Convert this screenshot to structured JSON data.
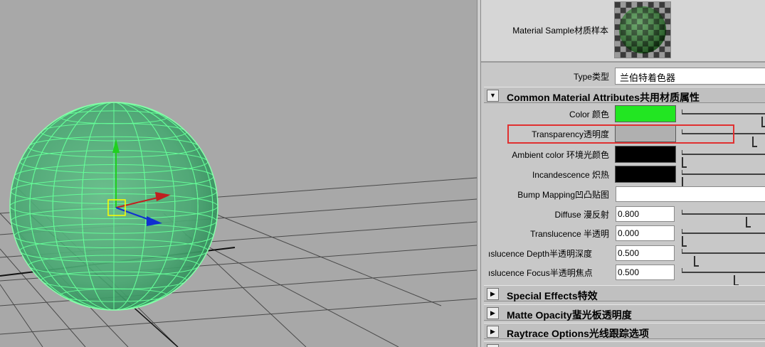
{
  "material_sample": {
    "label": "Material Sample材质样本"
  },
  "type_row": {
    "label": "Type类型",
    "value": "兰伯特着色器"
  },
  "common_section": {
    "title": "Common Material Attributes共用材质属性",
    "arrow": "▼"
  },
  "attributes": {
    "color": {
      "label": "Color 颜色",
      "swatch": "#22e622",
      "level": 1.0
    },
    "transparency": {
      "label": "Transparency透明度",
      "swatch": "#b0b0b0",
      "level": 0.88
    },
    "ambient": {
      "label": "Ambient color 环境光颜色",
      "swatch": "#000000",
      "level": 0.0
    },
    "incandescence": {
      "label": "Incandescence 炽热",
      "swatch": "#000000",
      "level": 0.0
    },
    "bump": {
      "label": "Bump Mapping凹凸贴图"
    },
    "diffuse": {
      "label": "Diffuse 漫反射",
      "value": "0.800",
      "level": 0.8
    },
    "translucence": {
      "label": "Translucence 半透明",
      "value": "0.000",
      "level": 0.0
    },
    "translucence_depth": {
      "label": "ıslucence Depth半透明深度",
      "value": "0.500",
      "level": 0.15
    },
    "translucence_focus": {
      "label": "ıslucence Focus半透明焦点",
      "value": "0.500",
      "level": 0.65
    }
  },
  "collapsed_sections": [
    {
      "title": "Special Effects特效",
      "arrow": "▶"
    },
    {
      "title": "Matte Opacity蜚光板透明度",
      "arrow": "▶"
    },
    {
      "title": "Raytrace Options光线跟踪选项",
      "arrow": "▶"
    }
  ],
  "colors": {
    "viewport_bg": "#a8a8a8",
    "sphere_wire": "#66ff99",
    "highlight_box": "#e03030",
    "gizmo_y": "#1fd01f",
    "gizmo_x": "#c02020",
    "gizmo_z": "#1030d0",
    "gizmo_center": "#ffff00"
  }
}
